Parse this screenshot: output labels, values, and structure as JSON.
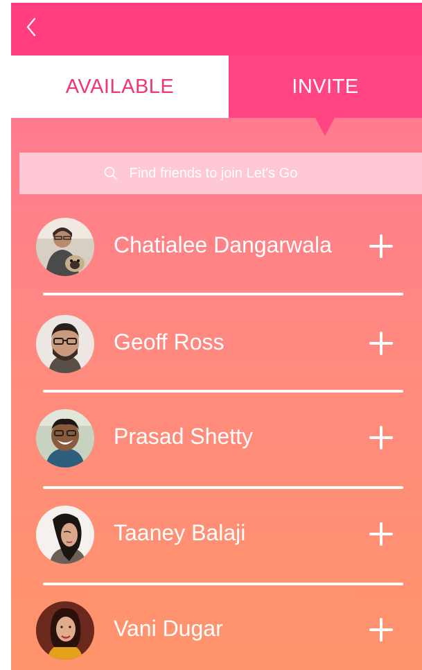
{
  "tabs": {
    "available": "AVAILABLE",
    "invite": "INVITE",
    "active": "invite"
  },
  "search": {
    "placeholder": "Find friends to join Let's Go"
  },
  "friends": [
    {
      "name": "Chatialee Dangarwala",
      "action": "add"
    },
    {
      "name": "Geoff Ross",
      "action": "add"
    },
    {
      "name": "Prasad Shetty",
      "action": "add"
    },
    {
      "name": "Taaney Balaji",
      "action": "add"
    },
    {
      "name": "Vani Dugar",
      "action": "add"
    }
  ],
  "colors": {
    "header": "#ff3d7f",
    "accent": "#f0366f",
    "gradient_top": "#ff7597",
    "gradient_bottom": "#ff946b"
  },
  "icons": {
    "back": "chevron-left-icon",
    "search": "search-icon",
    "add": "plus-icon"
  }
}
